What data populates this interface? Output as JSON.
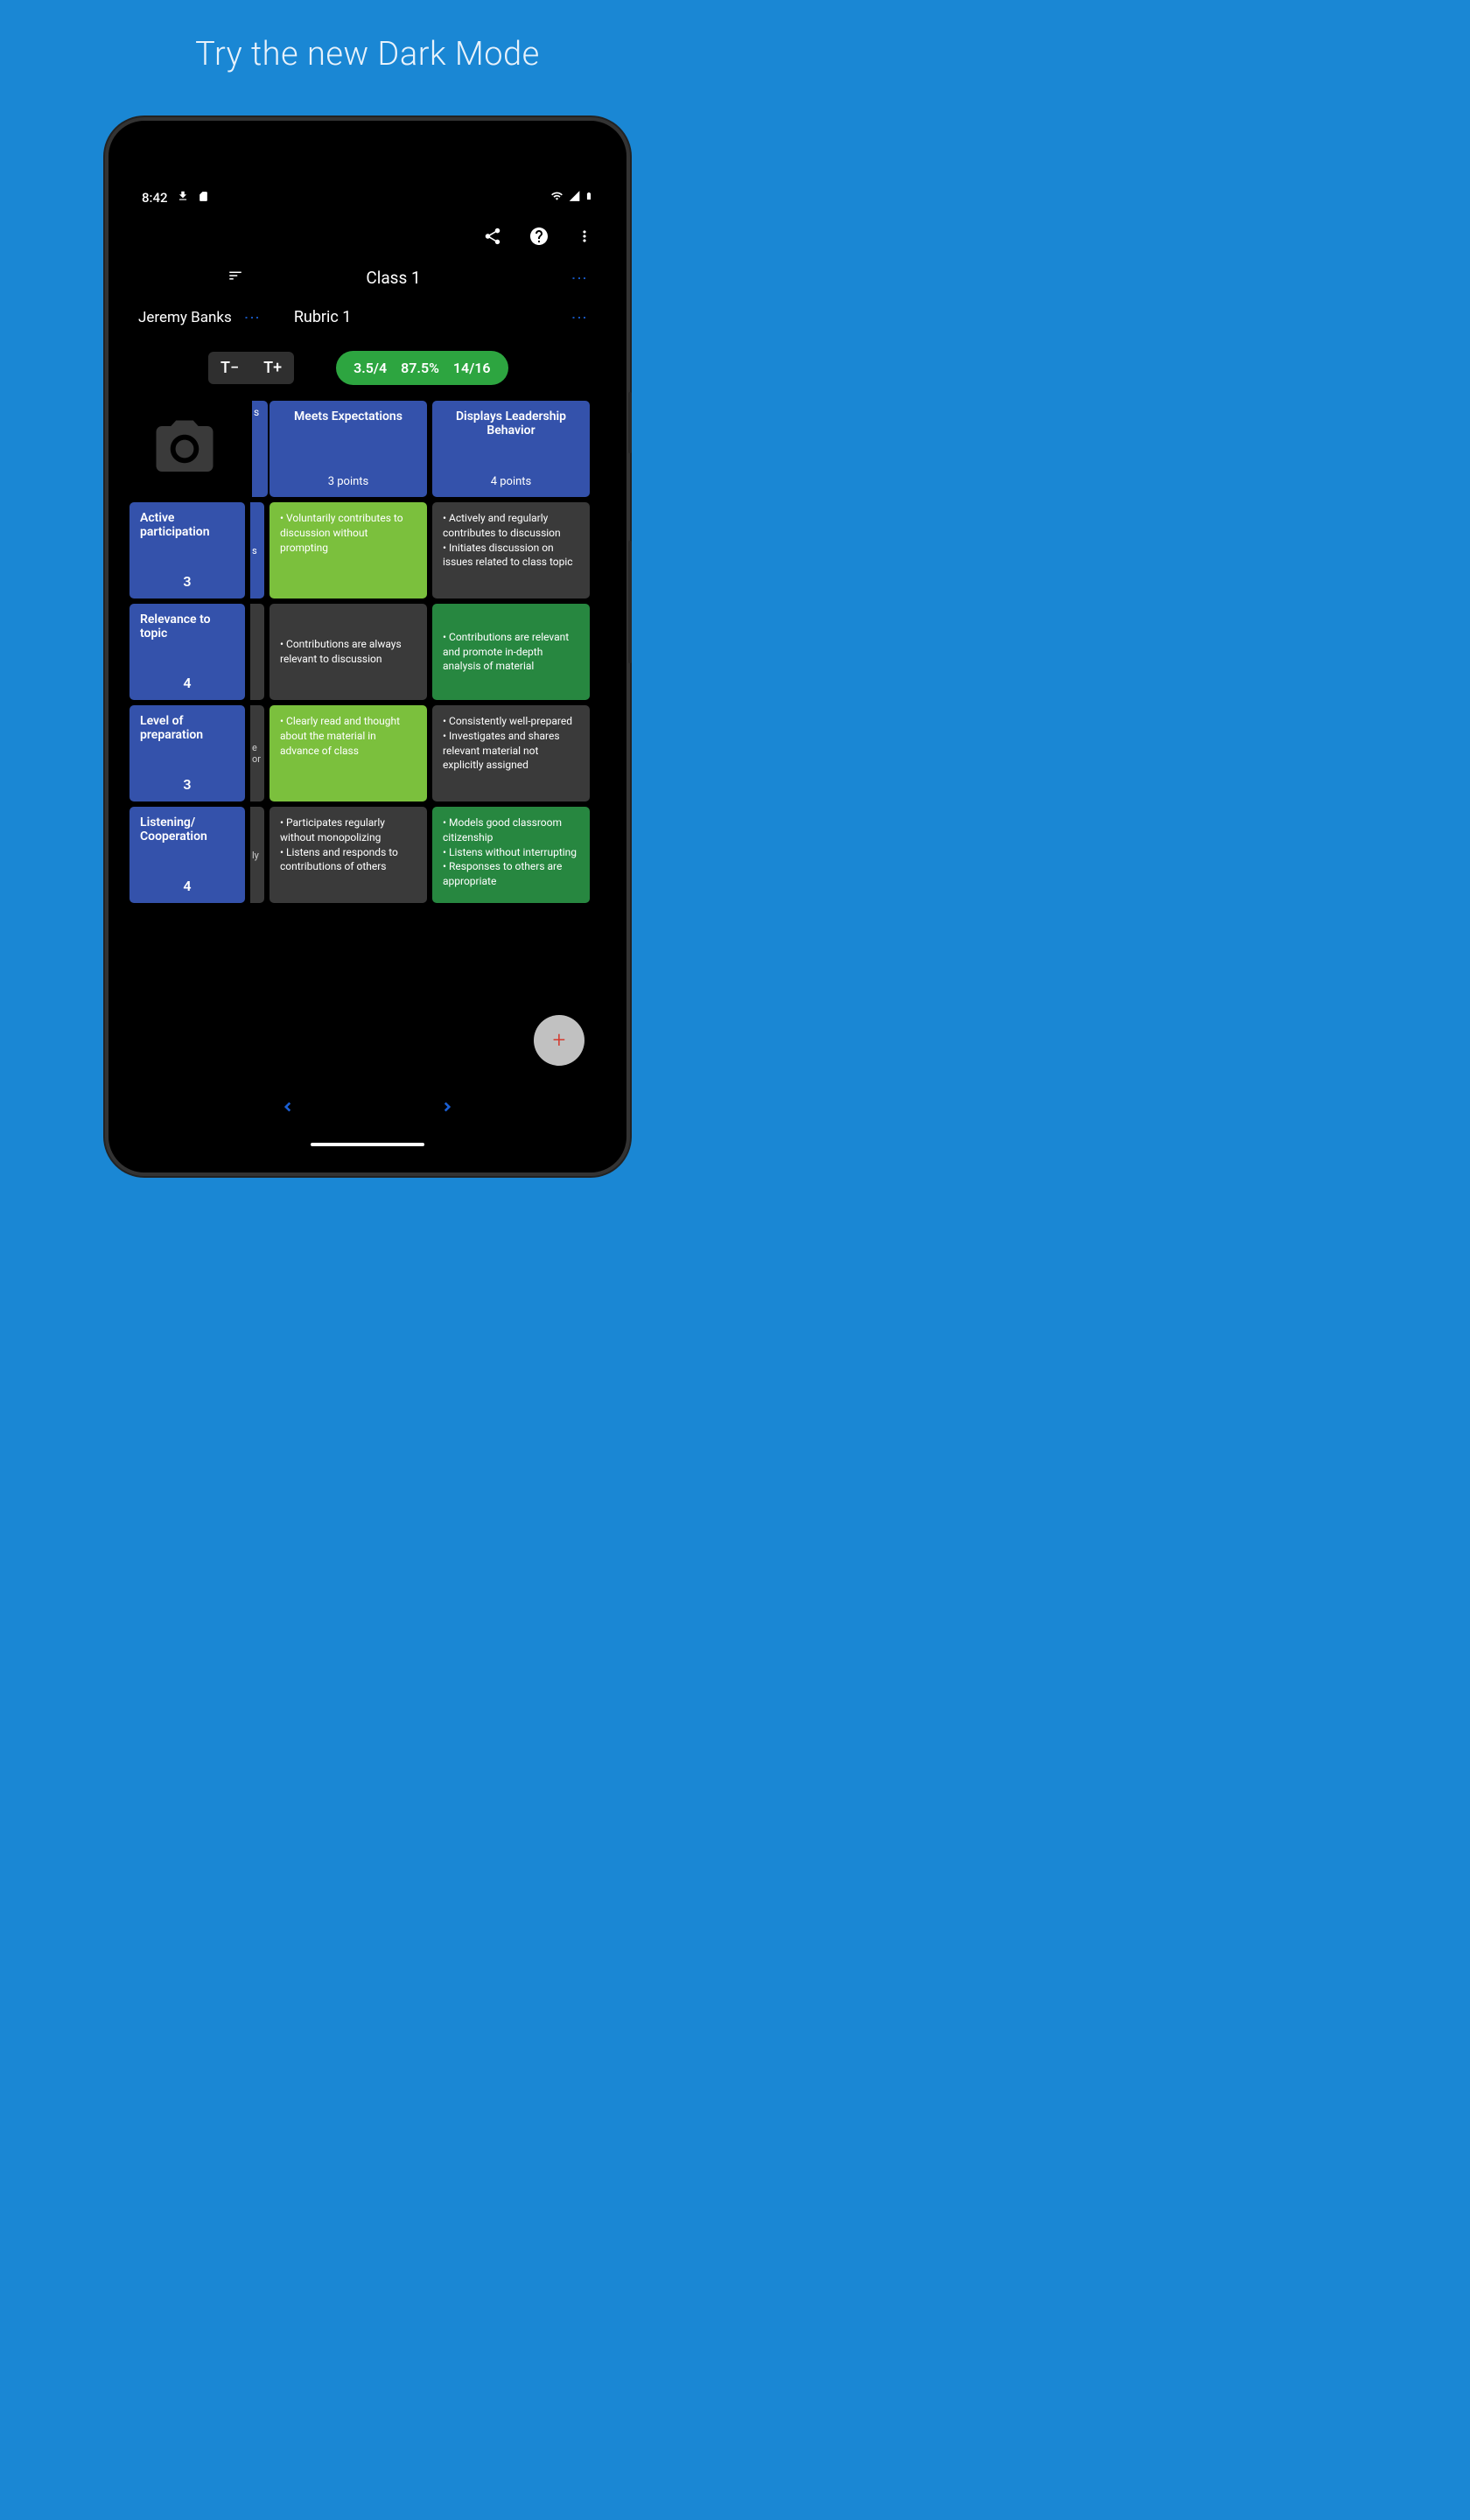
{
  "promo": {
    "title": "Try the new Dark Mode"
  },
  "status": {
    "time": "8:42"
  },
  "toolbar": {
    "class_label": "Class 1",
    "student_name": "Jeremy Banks",
    "rubric_label": "Rubric 1",
    "text_minus": "T−",
    "text_plus": "T+"
  },
  "scores": {
    "avg": "3.5/4",
    "percent": "87.5%",
    "total": "14/16"
  },
  "columns": [
    {
      "title": "Meets Expectations",
      "points": "3 points"
    },
    {
      "title": "Displays Leadership Behavior",
      "points": "4 points"
    }
  ],
  "rows": [
    {
      "name": "Active participation",
      "score": "3",
      "sliver": "s",
      "cells": [
        {
          "text": "• Voluntarily contributes to discussion without prompting",
          "color": "green-light"
        },
        {
          "text": "• Actively and regularly contributes to discussion\n• Initiates discussion on issues related to class topic",
          "color": "gray"
        }
      ]
    },
    {
      "name": "Relevance to topic",
      "score": "4",
      "sliver": "",
      "cells": [
        {
          "text": "• Contributions are always relevant to discussion",
          "color": "gray"
        },
        {
          "text": "• Contributions are relevant and promote in-depth analysis of material",
          "color": "green-dark"
        }
      ]
    },
    {
      "name": "Level of preparation",
      "score": "3",
      "sliver": "e\nor",
      "cells": [
        {
          "text": "• Clearly read and thought about the material in advance of class",
          "color": "green-light"
        },
        {
          "text": "• Consistently well-prepared\n• Investigates and shares relevant material not explicitly assigned",
          "color": "gray"
        }
      ]
    },
    {
      "name": "Listening/\nCooperation",
      "score": "4",
      "sliver": "ly",
      "cells": [
        {
          "text": "• Participates regularly without monopolizing\n• Listens and responds to contributions of others",
          "color": "gray"
        },
        {
          "text": "• Models good classroom citizenship\n• Listens without interrupting\n• Responses to others are appropriate",
          "color": "green-dark"
        }
      ]
    }
  ]
}
